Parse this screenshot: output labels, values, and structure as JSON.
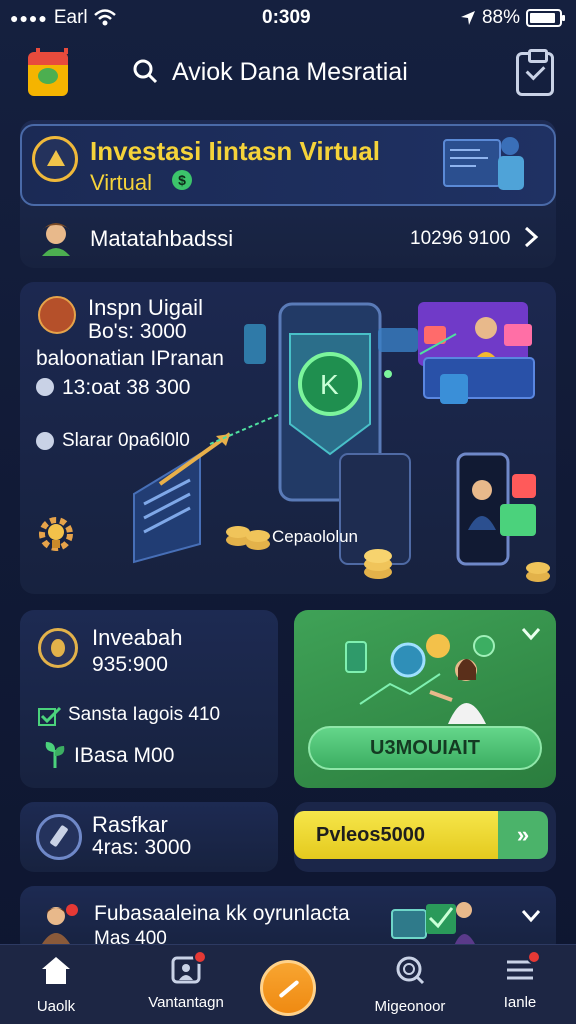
{
  "status_bar": {
    "dots": "●●●●",
    "carrier": "Earl",
    "time": "0:309",
    "battery": "88%",
    "battery_level": 0.88
  },
  "header": {
    "title": "Aviok Dana Mesratiai"
  },
  "hero": {
    "title": "Investasi Iintasn Virtual",
    "subtitle": "Virtual",
    "money_glyph": "$"
  },
  "account_row": {
    "label": "Matatahbadssi",
    "value": "10296 9100"
  },
  "feature": {
    "line1": "Inspn Uigail",
    "line2": "Bo's: 3000",
    "line3": "baloonatian IPranan",
    "line4": "13:oat 38 300",
    "line5": "Slarar 0pa6l0l0",
    "coins_label": "Cepaololun"
  },
  "invest_card": {
    "title": "Inveabah",
    "amount": "935:900",
    "check_line": "Sansta Iagois 410",
    "plant_line": "IBasa M00"
  },
  "green_card": {
    "button_label": "U3MOUIAIT"
  },
  "rasfkar_card": {
    "title": "Rasfkar",
    "amount": "4ras: 3000"
  },
  "yellow_card": {
    "button_label": "Pvleos5000",
    "arrow_label": "»"
  },
  "bottom_card": {
    "title": "Fubasaaleina kk oyrunlacta",
    "subtitle": "Mas 400"
  },
  "tabs": [
    {
      "label": "Uaolk"
    },
    {
      "label": "Vantantagn"
    },
    {
      "label": "Migeonoor"
    },
    {
      "label": "Ianle"
    }
  ]
}
